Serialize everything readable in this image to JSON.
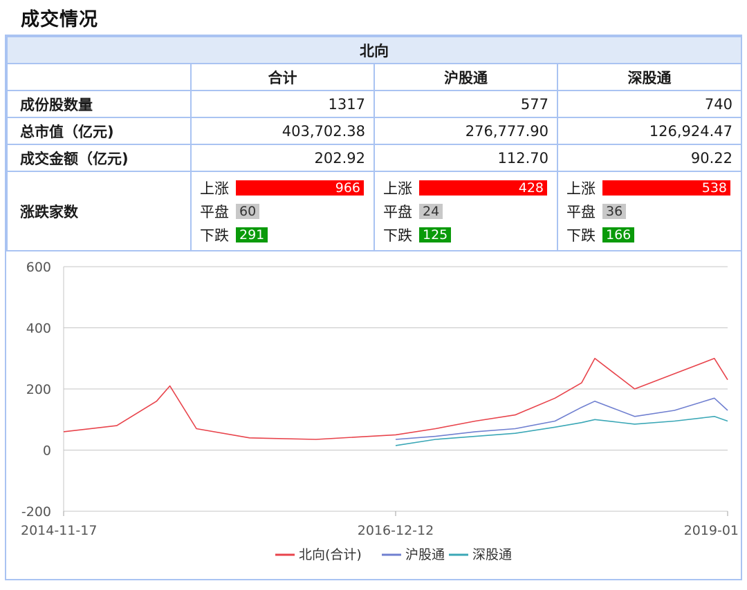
{
  "page_title": "成交情况",
  "table": {
    "group_header": "北向",
    "columns": [
      "合计",
      "沪股通",
      "深股通"
    ],
    "rows": [
      {
        "label": "成份股数量",
        "values": [
          "1317",
          "577",
          "740"
        ]
      },
      {
        "label": "总市值（亿元)",
        "values": [
          "403,702.38",
          "276,777.90",
          "126,924.47"
        ]
      },
      {
        "label": "成交金额（亿元)",
        "values": [
          "202.92",
          "112.70",
          "90.22"
        ]
      }
    ],
    "adv_decl": {
      "label": "涨跌家数",
      "up_label": "上涨",
      "flat_label": "平盘",
      "down_label": "下跌",
      "columns": [
        {
          "up": "966",
          "flat": "60",
          "down": "291"
        },
        {
          "up": "428",
          "flat": "24",
          "down": "125"
        },
        {
          "up": "538",
          "flat": "36",
          "down": "166"
        }
      ]
    }
  },
  "colors": {
    "border": "#a9c3f2",
    "header_bg": "#dfe9f8",
    "up": "#ff0000",
    "flat": "#c8c8c8",
    "down": "#0a9a0a"
  },
  "chart_data": {
    "type": "line",
    "x_ticks": [
      "2014-11-17",
      "2016-12-12",
      "2019-01"
    ],
    "y_ticks": [
      "600",
      "400",
      "200",
      "0",
      "-200"
    ],
    "ylim": [
      -200,
      600
    ],
    "grid": true,
    "legend_position": "bottom",
    "series": [
      {
        "name": "北向(合计)",
        "color": "#e8434b",
        "x": [
          "2014-11",
          "2015-03",
          "2015-06",
          "2015-07",
          "2015-09",
          "2016-01",
          "2016-06",
          "2016-12",
          "2017-03",
          "2017-06",
          "2017-09",
          "2017-12",
          "2018-02",
          "2018-03",
          "2018-06",
          "2018-09",
          "2018-12",
          "2019-01"
        ],
        "values": [
          60,
          80,
          160,
          210,
          70,
          40,
          35,
          50,
          70,
          95,
          115,
          170,
          220,
          300,
          200,
          250,
          300,
          230
        ]
      },
      {
        "name": "沪股通",
        "color": "#6f7fd0",
        "x": [
          "2016-12",
          "2017-03",
          "2017-06",
          "2017-09",
          "2017-12",
          "2018-02",
          "2018-03",
          "2018-06",
          "2018-09",
          "2018-12",
          "2019-01"
        ],
        "values": [
          35,
          45,
          60,
          70,
          95,
          140,
          160,
          110,
          130,
          170,
          130
        ]
      },
      {
        "name": "深股通",
        "color": "#3aa7b6",
        "x": [
          "2016-12",
          "2017-03",
          "2017-06",
          "2017-09",
          "2017-12",
          "2018-02",
          "2018-03",
          "2018-06",
          "2018-09",
          "2018-12",
          "2019-01"
        ],
        "values": [
          15,
          35,
          45,
          55,
          75,
          90,
          100,
          85,
          95,
          110,
          95
        ]
      }
    ]
  }
}
